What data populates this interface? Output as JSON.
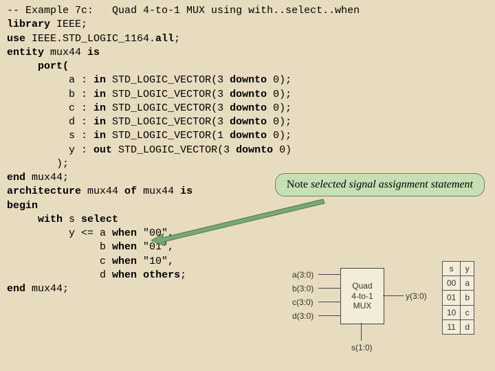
{
  "code": {
    "comment_prefix": "-- Example 7c:",
    "comment_rest": "   Quad 4-to-1 MUX using with..select..when",
    "line2_a": "library",
    "line2_b": " IEEE;",
    "line3_a": "use",
    "line3_b": " IEEE.STD_LOGIC_1164.",
    "line3_c": "all",
    "line3_d": ";",
    "line4_a": "entity",
    "line4_b": " mux44 ",
    "line4_c": "is",
    "line5": "     port(",
    "p_a_n": "          a : ",
    "p_a_k": "in",
    "p_a_t": " STD_LOGIC_VECTOR(3 ",
    "p_a_d": "downto",
    "p_a_e": " 0);",
    "p_b_n": "          b : ",
    "p_b_k": "in",
    "p_b_t": " STD_LOGIC_VECTOR(3 ",
    "p_b_d": "downto",
    "p_b_e": " 0);",
    "p_c_n": "          c : ",
    "p_c_k": "in",
    "p_c_t": " STD_LOGIC_VECTOR(3 ",
    "p_c_d": "downto",
    "p_c_e": " 0);",
    "p_d_n": "          d : ",
    "p_d_k": "in",
    "p_d_t": " STD_LOGIC_VECTOR(3 ",
    "p_d_d": "downto",
    "p_d_e": " 0);",
    "p_s_n": "          s : ",
    "p_s_k": "in",
    "p_s_t": " STD_LOGIC_VECTOR(1 ",
    "p_s_d": "downto",
    "p_s_e": " 0);",
    "p_y_n": "          y : ",
    "p_y_k": "out",
    "p_y_t": " STD_LOGIC_VECTOR(3 ",
    "p_y_d": "downto",
    "p_y_e": " 0)",
    "line12": "        );",
    "line13_a": "end",
    "line13_b": " mux44;",
    "line14_a": "architecture",
    "line14_b": " mux44 ",
    "line14_c": "of",
    "line14_d": " mux44 ",
    "line14_e": "is",
    "line15": "begin",
    "line16_a": "     with",
    "line16_b": " s ",
    "line16_c": "select",
    "line17_a": "          y <= a ",
    "line17_b": "when",
    "line17_c": " \"00\",",
    "line18_a": "               b ",
    "line18_b": "when",
    "line18_c": " \"01\",",
    "line19_a": "               c ",
    "line19_b": "when",
    "line19_c": " \"10\",",
    "line20_a": "               d ",
    "line20_b": "when",
    "line20_c": " ",
    "line20_d": "others",
    "line20_e": ";",
    "line21_a": "end",
    "line21_b": " mux44;"
  },
  "callout": {
    "lead": "Note ",
    "italic": "selected signal assignment statement"
  },
  "diagram": {
    "box_l1": "Quad",
    "box_l2": "4-to-1",
    "box_l3": "MUX",
    "a": "a(3:0)",
    "b": "b(3:0)",
    "c": "c(3:0)",
    "d": "d(3:0)",
    "y": "y(3:0)",
    "s": "s(1:0)"
  },
  "truth": {
    "h1": "s",
    "h2": "y",
    "r1a": "00",
    "r1b": "a",
    "r2a": "01",
    "r2b": "b",
    "r3a": "10",
    "r3b": "c",
    "r4a": "11",
    "r4b": "d"
  }
}
